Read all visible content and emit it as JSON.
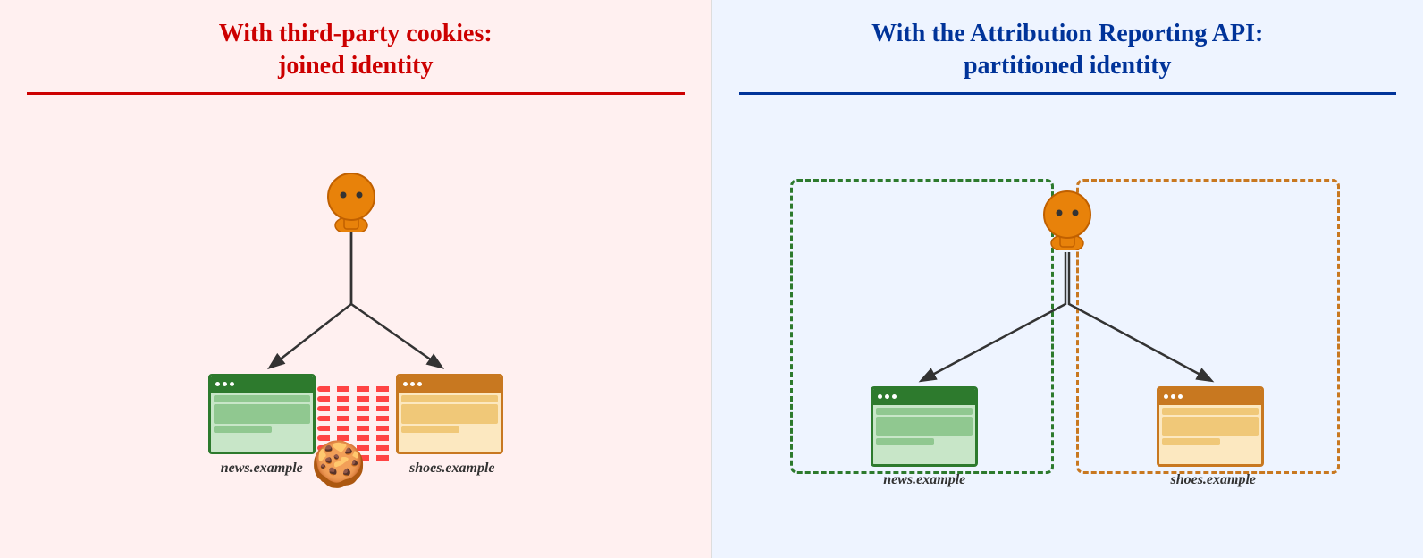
{
  "left_panel": {
    "title_line1": "With third-party cookies:",
    "title_line2": "joined identity",
    "site1_label": "news.example",
    "site2_label": "shoes.example"
  },
  "right_panel": {
    "title_line1": "With the Attribution Reporting API:",
    "title_line2": "partitioned identity",
    "site1_label": "news.example",
    "site2_label": "shoes.example"
  }
}
